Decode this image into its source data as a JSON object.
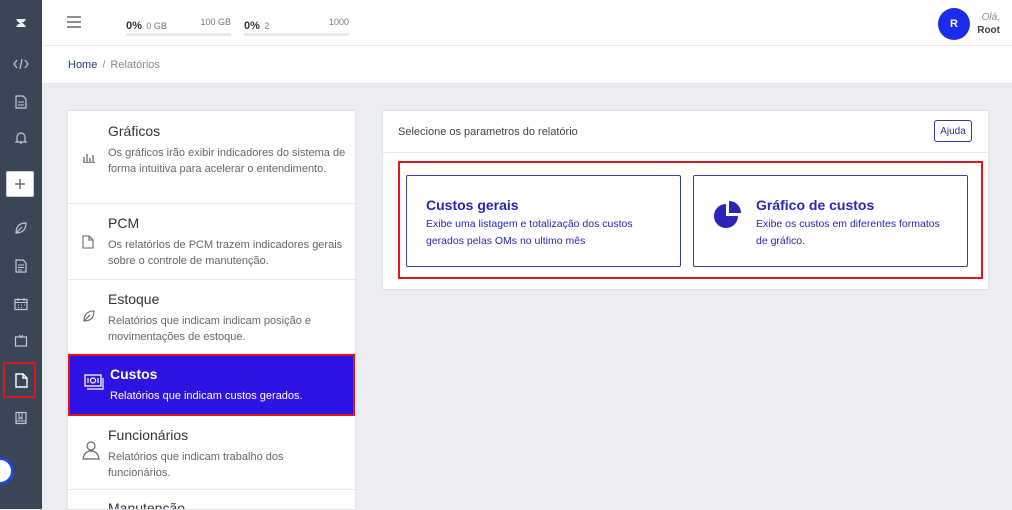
{
  "sidebar": {
    "items": [
      {
        "icon": "code-icon"
      },
      {
        "icon": "document-icon"
      },
      {
        "icon": "bell-icon"
      },
      {
        "icon": "plus-icon"
      },
      {
        "icon": "leaf-icon"
      },
      {
        "icon": "document-lines-icon"
      },
      {
        "icon": "calendar-icon"
      },
      {
        "icon": "tv-icon"
      },
      {
        "icon": "report-file-icon",
        "active": true
      },
      {
        "icon": "book-icon"
      }
    ]
  },
  "topbar": {
    "storage": {
      "percent": "0%",
      "used": "0 GB",
      "max": "100 GB"
    },
    "users": {
      "percent": "0%",
      "used": "2",
      "max": "1000"
    },
    "avatar_initial": "R",
    "greeting": "Olá,",
    "username": "Root"
  },
  "breadcrumb": {
    "home": "Home",
    "separator": "/",
    "current": "Relatórios"
  },
  "categories": [
    {
      "title": "Gráficos",
      "desc": "Os gráficos irão exibir indicadores do sistema de forma intuitiva para acelerar o entendimento.",
      "icon": "bar-chart-icon"
    },
    {
      "title": "PCM",
      "desc": "Os relatórios de PCM trazem indicadores gerais sobre o controle de manutenção.",
      "icon": "file-icon"
    },
    {
      "title": "Estoque",
      "desc": "Relatórios que indicam indicam posição e movimentações de estoque.",
      "icon": "leaf-icon"
    },
    {
      "title": "Custos",
      "desc": "Relatórios que indicam custos gerados.",
      "icon": "money-icon",
      "active": true
    },
    {
      "title": "Funcionários",
      "desc": "Relatórios que indicam trabalho dos funcionários.",
      "icon": "person-icon"
    },
    {
      "title": "Manutenção",
      "desc": "",
      "icon": "wrench-icon"
    }
  ],
  "params": {
    "header": "Selecione os parametros do relatório",
    "help_label": "Ajuda",
    "reports": [
      {
        "title": "Custos gerais",
        "desc_line1": "Exibe uma listagem e totalização dos custos",
        "desc_line2": "gerados pelas OMs no ultimo mês"
      },
      {
        "title": "Gráfico de custos",
        "desc_line1": "Exibe os custos em diferentes formatos",
        "desc_line2": "de gráfico.",
        "icon": "pie-chart-icon"
      }
    ]
  },
  "colors": {
    "accent": "#2d14e2",
    "highlight": "#e0161d",
    "sidebar": "#3a4556",
    "link": "#2a24b8"
  }
}
